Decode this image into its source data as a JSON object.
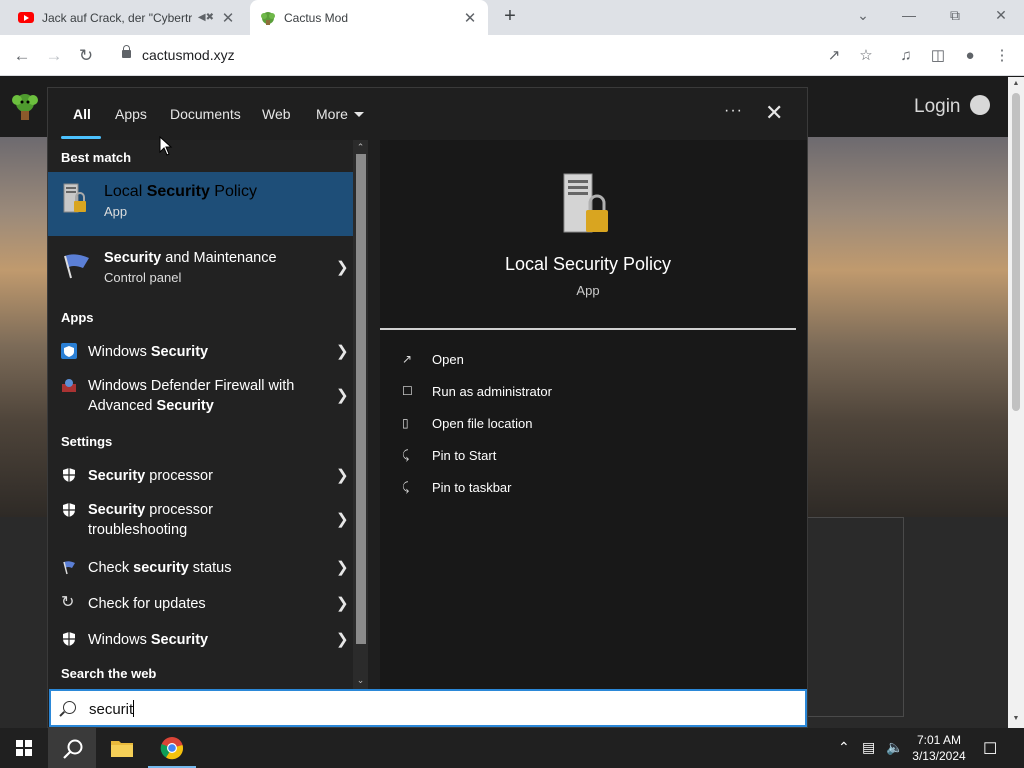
{
  "browser": {
    "tabs": [
      {
        "title": "Jack auf Crack, der \"Cybertro",
        "icon": "youtube-icon"
      },
      {
        "title": "Cactus Mod",
        "icon": "cactus-icon"
      }
    ],
    "url": "cactusmod.xyz"
  },
  "page": {
    "login_label": "Login"
  },
  "search": {
    "filters": [
      "All",
      "Apps",
      "Documents",
      "Web",
      "More"
    ],
    "active_filter": "All",
    "best_match_heading": "Best match",
    "best_match": {
      "title_pre": "Local ",
      "title_bold": "Security",
      "title_post": " Policy",
      "subtitle": "App"
    },
    "security_maintenance": {
      "title_bold": "Security",
      "title_post": " and Maintenance",
      "subtitle": "Control panel"
    },
    "apps_heading": "Apps",
    "apps": [
      {
        "pre": "Windows ",
        "bold": "Security",
        "post": ""
      },
      {
        "pre": "Windows Defender Firewall with",
        "line2_pre": "Advanced ",
        "bold": "Security"
      }
    ],
    "settings_heading": "Settings",
    "settings": [
      {
        "bold": "Security",
        "post": " processor"
      },
      {
        "bold": "Security",
        "post": " processor",
        "line2": "troubleshooting"
      },
      {
        "pre": "Check ",
        "bold": "security",
        "post": " status"
      },
      {
        "pre": "Check for updates"
      },
      {
        "pre": "Windows ",
        "bold": "Security",
        "post": ""
      }
    ],
    "web_heading": "Search the web",
    "query": "securit"
  },
  "preview": {
    "title": "Local Security Policy",
    "subtitle": "App",
    "actions": [
      "Open",
      "Run as administrator",
      "Open file location",
      "Pin to Start",
      "Pin to taskbar"
    ]
  },
  "taskbar": {
    "time": "7:01 AM",
    "date": "3/13/2024"
  },
  "colors": {
    "highlight": "#1e4e78",
    "accent": "#4cc2ff",
    "panel": "#1f1f1f"
  }
}
